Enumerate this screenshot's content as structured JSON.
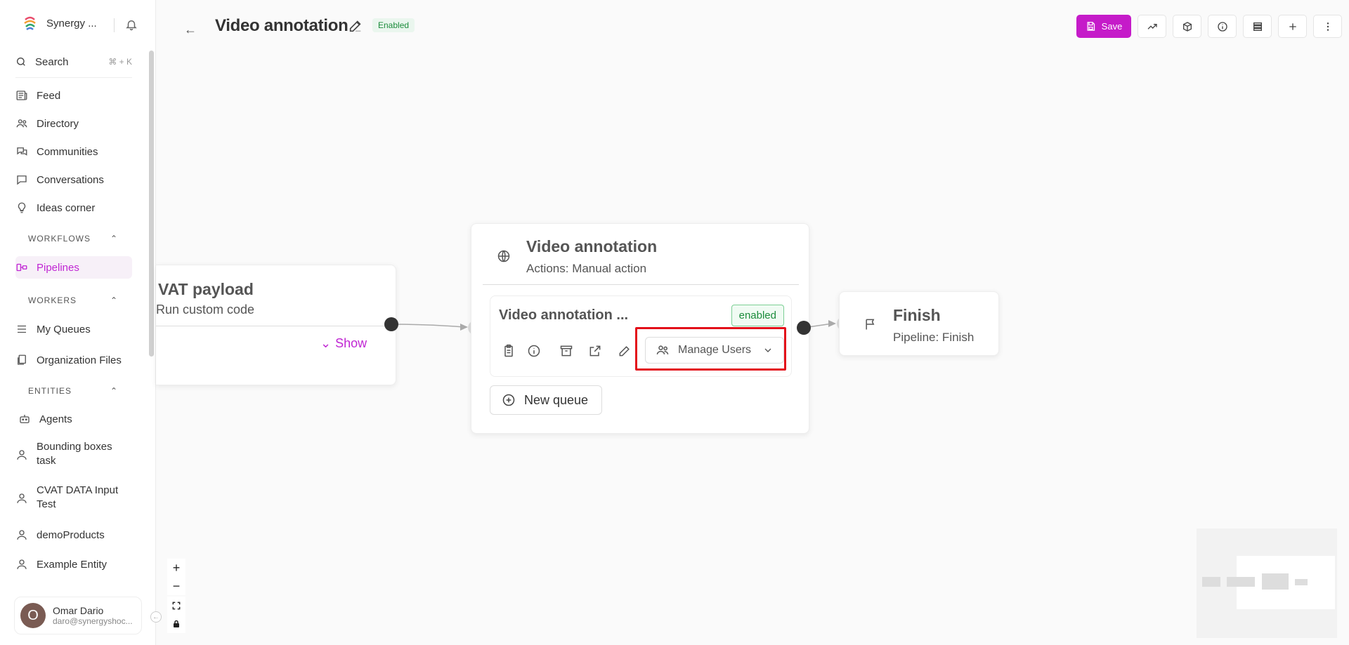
{
  "sidebar": {
    "brand_name": "Synergy ...",
    "search_label": "Search",
    "search_shortcut": "⌘ + K",
    "nav": [
      {
        "label": "Feed",
        "icon": "newspaper-icon"
      },
      {
        "label": "Directory",
        "icon": "users-icon"
      },
      {
        "label": "Communities",
        "icon": "chat-bubbles-icon"
      },
      {
        "label": "Conversations",
        "icon": "message-icon"
      },
      {
        "label": "Ideas corner",
        "icon": "lightbulb-icon"
      }
    ],
    "sections": {
      "workflows": "WORKFLOWS",
      "workers": "WORKERS",
      "entities": "ENTITIES"
    },
    "workflows_items": [
      {
        "label": "Pipelines",
        "icon": "pipelines-icon"
      }
    ],
    "workers_items": [
      {
        "label": "My Queues",
        "icon": "list-icon"
      },
      {
        "label": "Organization Files",
        "icon": "files-icon"
      }
    ],
    "entities_items": [
      {
        "label": "Agents",
        "icon": "robot-icon"
      },
      {
        "label": "Bounding boxes task",
        "icon": "user-icon"
      },
      {
        "label": "CVAT DATA Input Test",
        "icon": "user-icon"
      },
      {
        "label": "demoProducts",
        "icon": "user-icon"
      },
      {
        "label": "Example Entity",
        "icon": "user-icon"
      }
    ],
    "user": {
      "initial": "O",
      "name": "Omar Dario",
      "email": "daro@synergyshoc..."
    }
  },
  "header": {
    "title": "Video annotation",
    "status_badge": "Enabled",
    "save_label": "Save"
  },
  "canvas": {
    "cvat_node": {
      "title": "VAT payload",
      "subtitle": "Run custom code",
      "show_label": "Show"
    },
    "video_node": {
      "title": "Video annotation",
      "subtitle": "Actions: Manual action",
      "queue": {
        "title": "Video annotation ...",
        "status": "enabled",
        "manage_users_label": "Manage Users"
      },
      "new_queue_label": "New queue"
    },
    "finish_node": {
      "title": "Finish",
      "subtitle": "Pipeline: Finish"
    },
    "zoom_controls": {
      "zoom_in": "+",
      "zoom_out": "−"
    }
  },
  "colors": {
    "accent": "#c51bc9",
    "highlight": "#e3101a",
    "enabled_green": "#1c8c3c"
  }
}
